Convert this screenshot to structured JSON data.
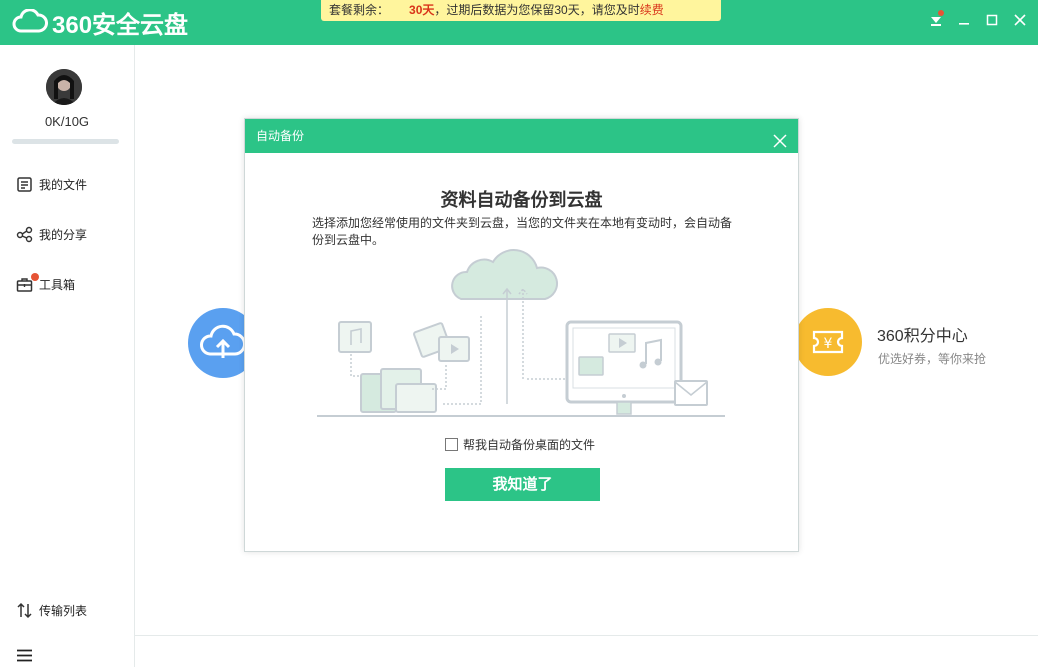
{
  "app": {
    "title": "360安全云盘"
  },
  "notice": {
    "prefix": "套餐剩余：",
    "days": "30天",
    "message": "，过期后数据为您保留30天，请您及时",
    "renew": "续费"
  },
  "window_controls": [
    "download-icon",
    "minimize-icon",
    "maximize-icon",
    "close-icon"
  ],
  "sidebar": {
    "storage": "0K/10G",
    "storage_used_fraction": 0.0,
    "items": [
      {
        "label": "我的文件",
        "icon": "file-list-icon"
      },
      {
        "label": "我的分享",
        "icon": "share-icon"
      },
      {
        "label": "工具箱",
        "icon": "toolbox-icon",
        "badge": true
      }
    ],
    "transfer": {
      "label": "传输列表",
      "icon": "transfer-icon"
    },
    "menu_icon": "hamburger-menu-icon"
  },
  "main": {
    "upload_icon": "cloud-upload-icon",
    "points": {
      "title": "360积分中心",
      "subtitle": "优选好券，等你来抢",
      "icon": "yen-ticket-icon"
    }
  },
  "dialog": {
    "header": "自动备份",
    "title": "资料自动备份到云盘",
    "description": "选择添加您经常使用的文件夹到云盘，当您的文件夹在本地有变动时，会自动备份到云盘中。",
    "checkbox_label": "帮我自动备份桌面的文件",
    "checkbox_checked": false,
    "confirm_button": "我知道了"
  },
  "colors": {
    "brand_green": "#2cc487",
    "notice_yellow": "#fff59d",
    "alert_red": "#d9341a",
    "upload_blue": "#5aa0f0",
    "points_yellow": "#f7bb2f"
  }
}
